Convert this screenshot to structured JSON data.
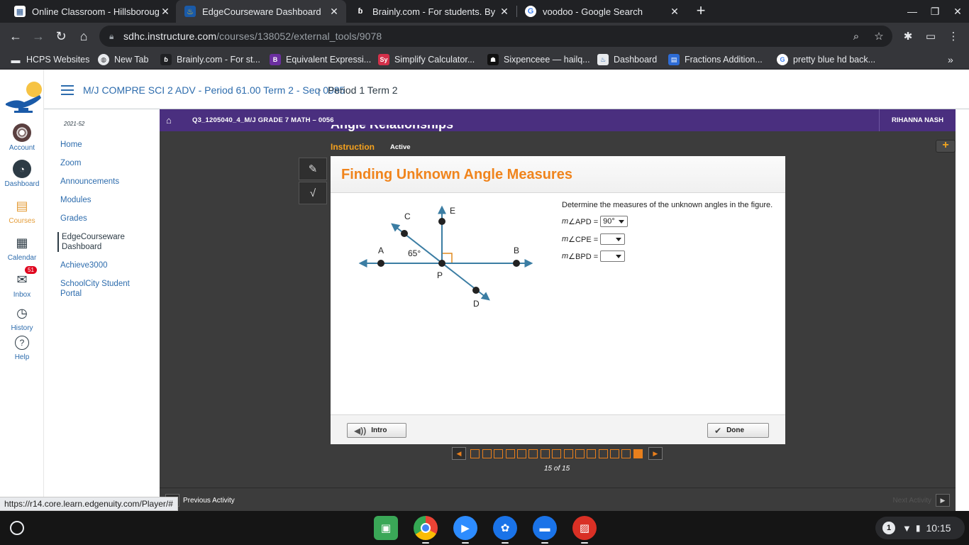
{
  "browser": {
    "tabs": [
      {
        "title": "Online Classroom - Hillsborough",
        "icon": "hcps-favicon",
        "color": "#ffffff"
      },
      {
        "title": "EdgeCourseware Dashboard",
        "icon": "canvas-lamp-favicon",
        "color": "#3a7bd5"
      },
      {
        "title": "Brainly.com - For students. By st",
        "icon": "brainly-favicon",
        "color": "#202124"
      },
      {
        "title": "voodoo - Google Search",
        "icon": "google-favicon",
        "color": "#ffffff"
      }
    ],
    "url_host": "sdhc.instructure.com",
    "url_path": "/courses/138052/external_tools/9078",
    "bookmarks": [
      {
        "label": "HCPS Websites",
        "icon": "folder-icon"
      },
      {
        "label": "New Tab",
        "icon": "globe-icon"
      },
      {
        "label": "Brainly.com - For st...",
        "icon": "brainly-icon"
      },
      {
        "label": "Equivalent Expressi...",
        "icon": "b-icon"
      },
      {
        "label": "Simplify Calculator...",
        "icon": "sy-icon"
      },
      {
        "label": "Sixpenceee — hailq...",
        "icon": "ghost-icon"
      },
      {
        "label": "Dashboard",
        "icon": "lamp-icon"
      },
      {
        "label": "Fractions Addition...",
        "icon": "doc-icon"
      },
      {
        "label": "pretty blue hd back...",
        "icon": "google-icon"
      }
    ]
  },
  "global_nav": {
    "items": [
      {
        "label": "Account",
        "icon": "avatar-icon"
      },
      {
        "label": "Dashboard",
        "icon": "dashboard-icon"
      },
      {
        "label": "Courses",
        "icon": "courses-icon"
      },
      {
        "label": "Calendar",
        "icon": "calendar-icon"
      },
      {
        "label": "Inbox",
        "icon": "inbox-icon",
        "badge": "51"
      },
      {
        "label": "History",
        "icon": "clock-icon"
      },
      {
        "label": "Help",
        "icon": "help-icon"
      }
    ]
  },
  "breadcrumb": {
    "course": "M/J COMPRE SCI 2 ADV - Period 61.00 Term 2 - Seq 0985",
    "separator": "›",
    "current": "Period 1 Term 2"
  },
  "course_nav": {
    "term": "2021-52",
    "items": [
      {
        "label": "Home"
      },
      {
        "label": "Zoom"
      },
      {
        "label": "Announcements"
      },
      {
        "label": "Modules"
      },
      {
        "label": "Grades"
      },
      {
        "label": "EdgeCourseware Dashboard",
        "active": true
      },
      {
        "label": "Achieve3000"
      },
      {
        "label": "SchoolCity Student Portal"
      }
    ]
  },
  "edgenuity": {
    "course_code": "Q3_1205040_4_M/J GRADE 7 MATH – 0056",
    "student": "RIHANNA NASH",
    "lesson_title": "Angle Relationships",
    "section": "Instruction",
    "status": "Active",
    "card_title": "Finding Unknown Angle Measures",
    "prompt": "Determine the measures of the unknown angles in the figure.",
    "questions": [
      {
        "m": "m",
        "label": "∠APD =",
        "value": "90°"
      },
      {
        "m": "m",
        "label": "∠CPE =",
        "value": ""
      },
      {
        "m": "m",
        "label": "∠BPD =",
        "value": ""
      }
    ],
    "figure": {
      "point_labels": {
        "A": "A",
        "B": "B",
        "C": "C",
        "D": "D",
        "E": "E",
        "P": "P"
      },
      "angle_label": "65°"
    },
    "intro_label": "Intro",
    "done_label": "Done",
    "page_total": 15,
    "page_current": 15,
    "page_counter": "15 of 15",
    "prev_activity": "Previous Activity",
    "next_activity": "Next Activity",
    "accent": "#f0841c",
    "header_color": "#4a2f7f"
  },
  "status_url": "https://r14.core.learn.edgenuity.com/Player/#",
  "shelf": {
    "time": "10:15",
    "notifications": "1",
    "apps": [
      {
        "icon": "minecraft-icon",
        "color": "#3aa757"
      },
      {
        "icon": "chrome-icon",
        "color": "#ffffff"
      },
      {
        "icon": "zoom-icon",
        "color": "#2d8cff"
      },
      {
        "icon": "palette-icon",
        "color": "#1a73e8"
      },
      {
        "icon": "files-icon",
        "color": "#1a73e8"
      },
      {
        "icon": "gallery-icon",
        "color": "#d93025"
      }
    ]
  }
}
